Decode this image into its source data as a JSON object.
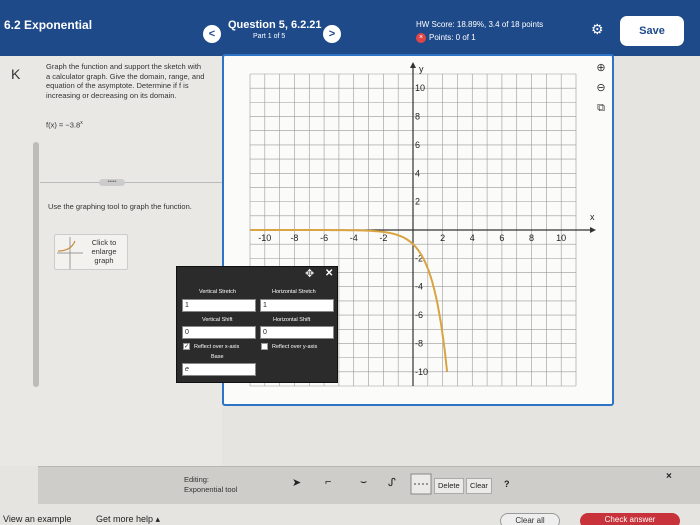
{
  "header": {
    "section_title": "6.2 Exponential",
    "question_title": "Question 5, 6.2.21",
    "question_part": "Part 1 of 5",
    "prev_glyph": "<",
    "next_glyph": ">",
    "hw_score": "HW Score: 18.89%, 3.4 of 18 points",
    "points": "Points: 0 of 1",
    "points_icon": "x-circle-icon",
    "settings_icon": "gear-icon",
    "save_label": "Save"
  },
  "left": {
    "collapse_glyph": "K",
    "instructions": "Graph the function and support the sketch with a calculator graph. Give the domain, range, and equation of the asymptote. Determine if f is increasing or decreasing on its domain.",
    "function_prefix": "f(x) = −3.8",
    "function_exponent": "x",
    "more_glyph": "•••••",
    "tool_instructions": "Use the graphing tool to graph the function.",
    "enlarge_label": "Click to enlarge graph"
  },
  "graph": {
    "x_label": "x",
    "y_label": "y",
    "x_ticks": [
      "-10",
      "-8",
      "-6",
      "-4",
      "-2",
      "2",
      "4",
      "6",
      "8",
      "10"
    ],
    "y_ticks": [
      "10",
      "8",
      "6",
      "4",
      "2",
      "-2",
      "-4",
      "-6",
      "-8",
      "-10"
    ],
    "curve_color": "#d9a441",
    "axis_color": "#333333",
    "border_color": "#2e74c4",
    "right_tools": [
      "zoom-in-icon",
      "zoom-out-icon",
      "popout-icon"
    ]
  },
  "popup": {
    "move_icon": "move-icon",
    "vertical_stretch_label": "Vertical Stretch",
    "vertical_stretch_value": "1",
    "horizontal_stretch_label": "Horizontal Stretch",
    "horizontal_stretch_value": "1",
    "vertical_shift_label": "Vertical Shift",
    "vertical_shift_value": "0",
    "horizontal_shift_label": "Horizontal Shift",
    "horizontal_shift_value": "0",
    "reflect_x_label": "Reflect over x-axis",
    "reflect_x_checked": true,
    "reflect_y_label": "Reflect over y-axis",
    "reflect_y_checked": false,
    "base_label": "Base",
    "base_value": "e"
  },
  "edit_bar": {
    "editing_label": "Editing:",
    "tool_name": "Exponential tool",
    "tools": [
      "pointer-icon",
      "curve-icon",
      "check-curve-icon",
      "exponential-curve-icon",
      "dashed-line-icon"
    ],
    "delete_label": "Delete",
    "clear_label": "Clear",
    "help_label": "?",
    "close_glyph": "×"
  },
  "footer": {
    "view_example": "View an example",
    "get_more_help": "Get more help ▴",
    "clear_all": "Clear all",
    "check_answer": "Check answer"
  }
}
